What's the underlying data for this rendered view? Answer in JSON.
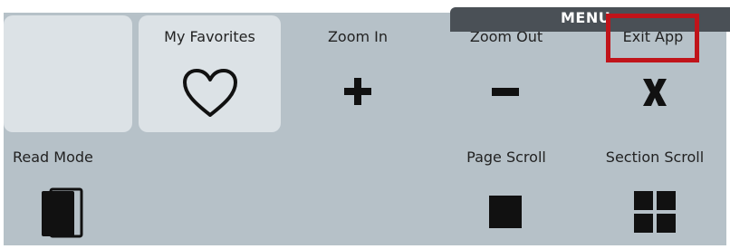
{
  "menu": {
    "title": "MENU"
  },
  "buttons": {
    "favorites": {
      "label": "My Favorites",
      "icon": "heart-icon"
    },
    "zoom_in": {
      "label": "Zoom In",
      "icon": "plus-icon"
    },
    "zoom_out": {
      "label": "Zoom Out",
      "icon": "minus-icon"
    },
    "exit_app": {
      "label": "Exit App",
      "icon": "x-icon"
    },
    "read_mode": {
      "label": "Read Mode",
      "icon": "book-icon"
    },
    "page_scroll": {
      "label": "Page Scroll",
      "icon": "square-icon"
    },
    "section_scroll": {
      "label": "Section Scroll",
      "icon": "grid-icon"
    }
  },
  "colors": {
    "panel": "#b6c1c8",
    "tile": "#dce2e6",
    "menu_tab": "#4a5056",
    "highlight": "#c0141a",
    "icon": "#111111"
  }
}
